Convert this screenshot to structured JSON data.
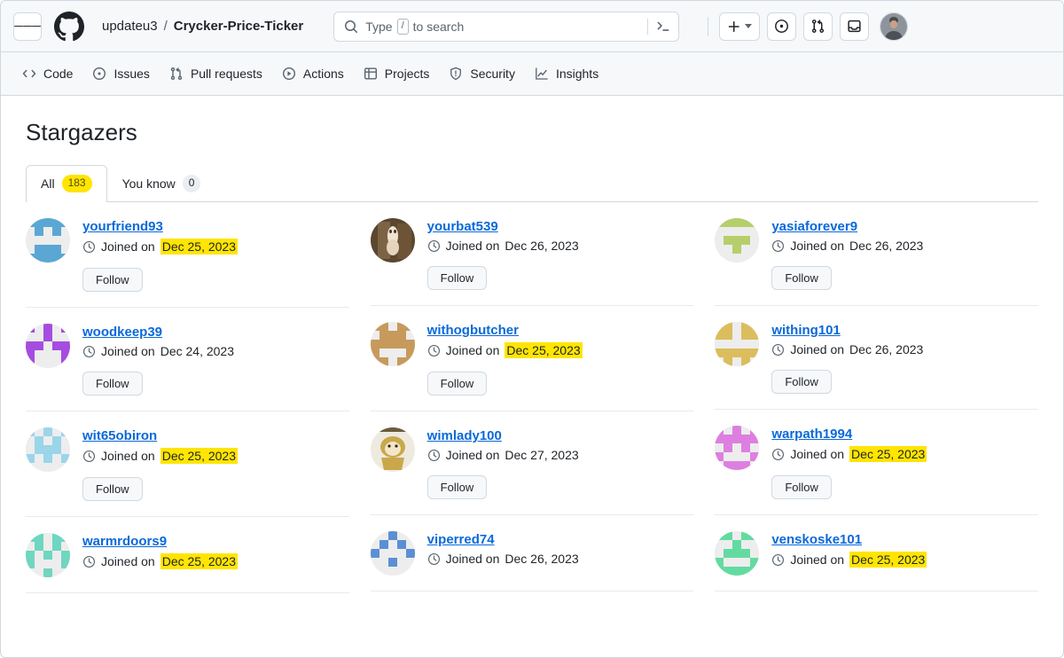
{
  "header": {
    "menu_icon": "hamburger-icon",
    "logo_icon": "github-logo-icon",
    "owner": "updateu3",
    "separator": "/",
    "repo": "Crycker-Price-Ticker",
    "search": {
      "icon": "search-icon",
      "placeholder_prefix": "Type",
      "placeholder_key": "/",
      "placeholder_suffix": "to search",
      "terminal_icon": "command-palette-icon"
    },
    "create_new_label": "+",
    "issues_icon": "issue-opened-icon",
    "pull_requests_icon": "git-pull-request-icon",
    "inbox_icon": "inbox-icon",
    "avatar_icon": "user-avatar"
  },
  "repo_nav": [
    {
      "label": "Code",
      "icon": "code-icon"
    },
    {
      "label": "Issues",
      "icon": "issue-opened-icon"
    },
    {
      "label": "Pull requests",
      "icon": "git-pull-request-icon"
    },
    {
      "label": "Actions",
      "icon": "play-icon"
    },
    {
      "label": "Projects",
      "icon": "table-icon"
    },
    {
      "label": "Security",
      "icon": "shield-icon"
    },
    {
      "label": "Insights",
      "icon": "graph-icon"
    }
  ],
  "main": {
    "title": "Stargazers",
    "tabs": [
      {
        "label": "All",
        "count": "183",
        "selected": true,
        "highlighted": true
      },
      {
        "label": "You know",
        "count": "0",
        "selected": false,
        "highlighted": false
      }
    ],
    "joined_prefix": "Joined on",
    "follow_label": "Follow",
    "clock_icon": "clock-icon",
    "highlight_color": "#ffe500",
    "link_color": "#0969da",
    "stargazers": [
      {
        "username": "yourfriend93",
        "joined_date": "Dec 25, 2023",
        "date_highlighted": true,
        "avatar_color": "#5aa7d4",
        "avatar_pattern": "identicon-1",
        "avatar_type": "identicon",
        "follow_label": "Follow"
      },
      {
        "username": "yourbat539",
        "joined_date": "Dec 26, 2023",
        "date_highlighted": false,
        "avatar_color": "#7a5c3a",
        "avatar_pattern": "photo-horse",
        "avatar_type": "photo",
        "follow_label": "Follow"
      },
      {
        "username": "yasiaforever9",
        "joined_date": "Dec 26, 2023",
        "date_highlighted": false,
        "avatar_color": "#b5cf6b",
        "avatar_pattern": "identicon-3",
        "avatar_type": "identicon",
        "follow_label": "Follow"
      },
      {
        "username": "woodkeep39",
        "joined_date": "Dec 24, 2023",
        "date_highlighted": false,
        "avatar_color": "#a64ce0",
        "avatar_pattern": "identicon-4",
        "avatar_type": "identicon",
        "follow_label": "Follow"
      },
      {
        "username": "withogbutcher",
        "joined_date": "Dec 25, 2023",
        "date_highlighted": true,
        "avatar_color": "#c79a5c",
        "avatar_pattern": "identicon-5",
        "avatar_type": "identicon",
        "follow_label": "Follow"
      },
      {
        "username": "withing101",
        "joined_date": "Dec 26, 2023",
        "date_highlighted": false,
        "avatar_color": "#dbbd5e",
        "avatar_pattern": "identicon-6",
        "avatar_type": "identicon",
        "follow_label": "Follow"
      },
      {
        "username": "wit65obiron",
        "joined_date": "Dec 25, 2023",
        "date_highlighted": true,
        "avatar_color": "#9ad5ea",
        "avatar_pattern": "identicon-7",
        "avatar_type": "identicon",
        "follow_label": "Follow"
      },
      {
        "username": "wimlady100",
        "joined_date": "Dec 27, 2023",
        "date_highlighted": false,
        "avatar_color": "#c8a84b",
        "avatar_pattern": "photo-lion",
        "avatar_type": "photo",
        "follow_label": "Follow"
      },
      {
        "username": "warpath1994",
        "joined_date": "Dec 25, 2023",
        "date_highlighted": true,
        "avatar_color": "#dd7fe0",
        "avatar_pattern": "identicon-9",
        "avatar_type": "identicon",
        "follow_label": "Follow"
      },
      {
        "username": "warmrdoors9",
        "joined_date": "Dec 25, 2023",
        "date_highlighted": true,
        "avatar_color": "#6fd6c0",
        "avatar_pattern": "identicon-10",
        "avatar_type": "identicon",
        "follow_label": ""
      },
      {
        "username": "viperred74",
        "joined_date": "Dec 26, 2023",
        "date_highlighted": false,
        "avatar_color": "#5b8fd4",
        "avatar_pattern": "identicon-11",
        "avatar_type": "identicon",
        "follow_label": ""
      },
      {
        "username": "venskoske101",
        "joined_date": "Dec 25, 2023",
        "date_highlighted": true,
        "avatar_color": "#63dba0",
        "avatar_pattern": "identicon-12",
        "avatar_type": "identicon",
        "follow_label": ""
      }
    ]
  }
}
